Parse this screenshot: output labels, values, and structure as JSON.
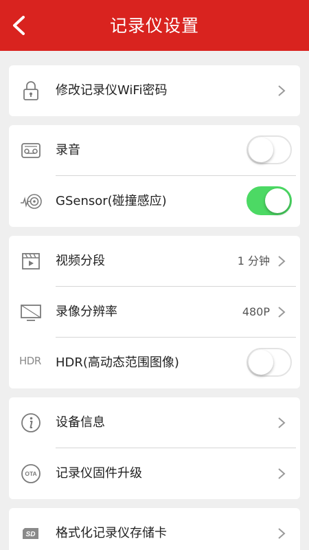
{
  "header": {
    "title": "记录仪设置",
    "back_icon": "chevron-left-icon",
    "color": "#d9231f"
  },
  "groups": [
    {
      "items": [
        {
          "label": "修改记录仪WiFi密码",
          "icon": "lock-icon",
          "control": "chevron"
        }
      ]
    },
    {
      "items": [
        {
          "label": "录音",
          "icon": "recorder-icon",
          "control": "toggle",
          "on": false
        },
        {
          "label": "GSensor(碰撞感应)",
          "icon": "gsensor-icon",
          "control": "toggle",
          "on": true
        }
      ]
    },
    {
      "items": [
        {
          "label": "视频分段",
          "icon": "video-clip-icon",
          "control": "chevron",
          "value": "1 分钟"
        },
        {
          "label": "录像分辨率",
          "icon": "monitor-icon",
          "control": "chevron",
          "value": "480P"
        },
        {
          "label": "HDR(高动态范围图像)",
          "icon_text": "HDR",
          "control": "toggle",
          "on": false
        }
      ]
    },
    {
      "items": [
        {
          "label": "设备信息",
          "icon": "info-icon",
          "control": "chevron"
        },
        {
          "label": "记录仪固件升级",
          "icon": "ota-icon",
          "icon_text": "OTA",
          "control": "chevron"
        }
      ]
    },
    {
      "items": [
        {
          "label": "格式化记录仪存储卡",
          "icon": "sd-card-icon",
          "icon_text": "SD",
          "control": "chevron"
        }
      ]
    }
  ],
  "colors": {
    "toggle_on": "#4cd964",
    "background": "#efefef"
  }
}
